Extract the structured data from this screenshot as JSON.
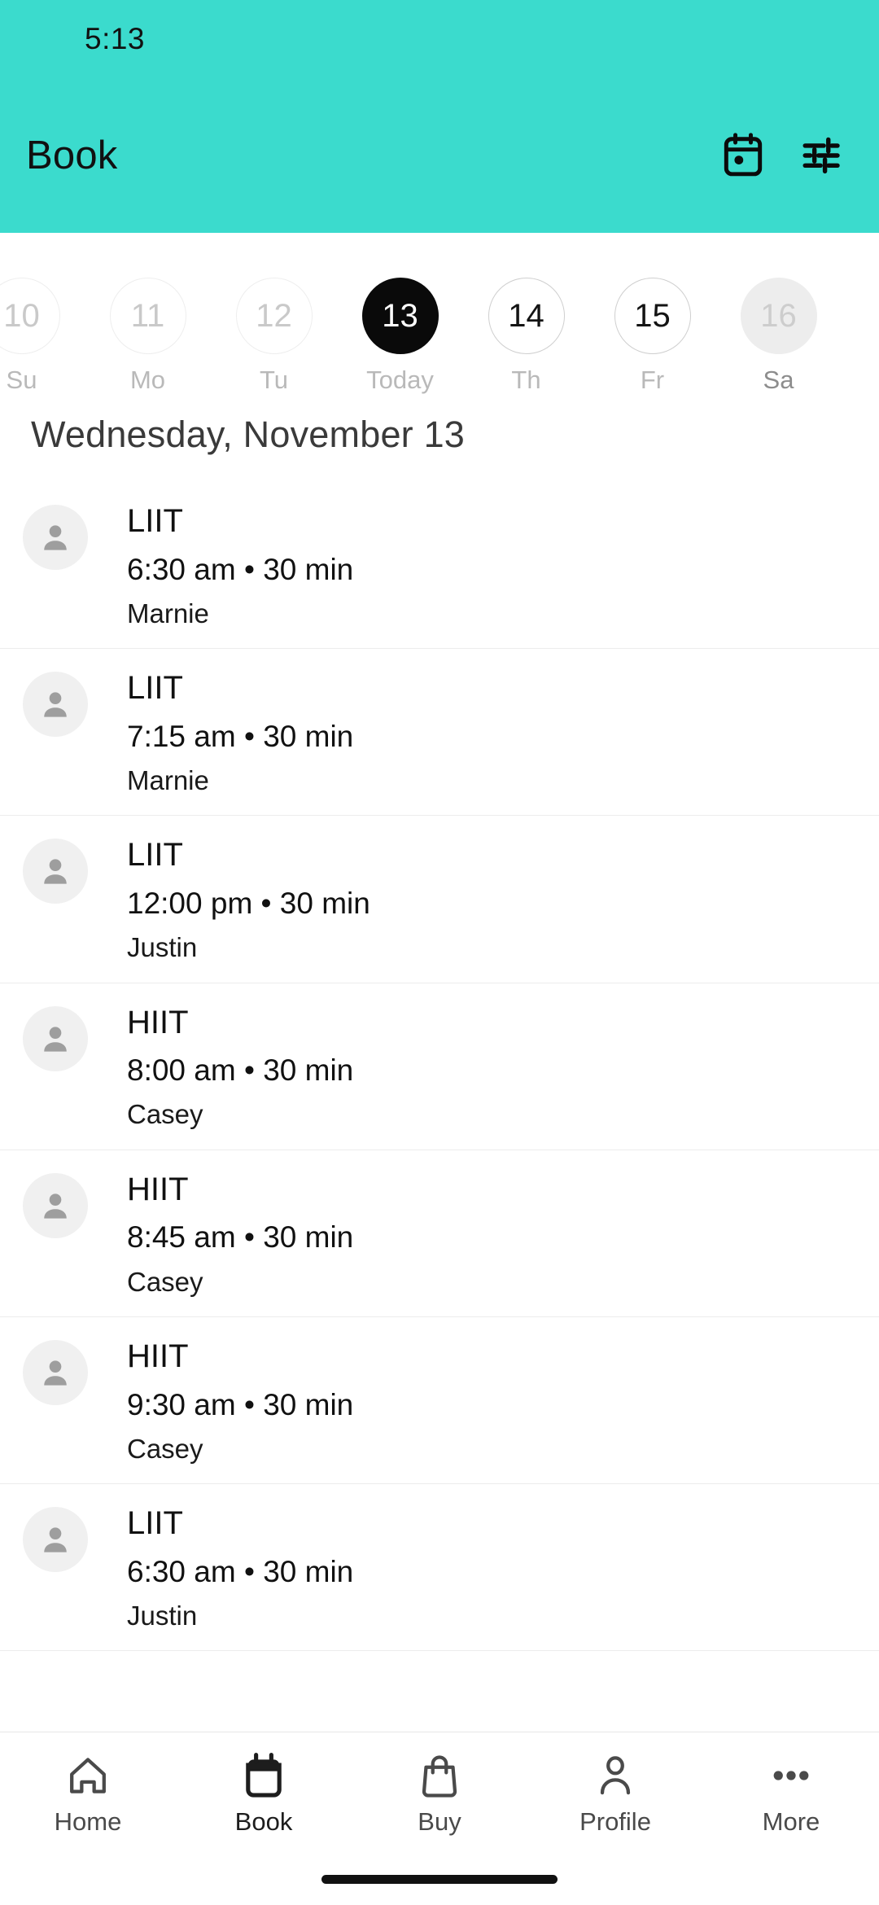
{
  "status_bar": {
    "clock": "5:13"
  },
  "app_bar": {
    "title": "Book",
    "calendar_icon": "calendar-icon",
    "filter_icon": "filter-sliders-icon"
  },
  "date_strip": {
    "days": [
      {
        "date": "10",
        "label": "Su",
        "state": "past"
      },
      {
        "date": "11",
        "label": "Mo",
        "state": "past"
      },
      {
        "date": "12",
        "label": "Tu",
        "state": "past"
      },
      {
        "date": "13",
        "label": "Today",
        "state": "today"
      },
      {
        "date": "14",
        "label": "Th",
        "state": "future"
      },
      {
        "date": "15",
        "label": "Fr",
        "state": "future"
      },
      {
        "date": "16",
        "label": "Sa",
        "state": "muted"
      }
    ]
  },
  "schedule": {
    "heading": "Wednesday, November 13",
    "classes": [
      {
        "name": "LIIT",
        "time": "6:30 am • 30 min",
        "coach": "Marnie",
        "avatar_icon": "person-avatar-icon"
      },
      {
        "name": "LIIT",
        "time": "7:15 am • 30 min",
        "coach": "Marnie",
        "avatar_icon": "person-avatar-icon"
      },
      {
        "name": "LIIT",
        "time": "12:00 pm • 30 min",
        "coach": "Justin",
        "avatar_icon": "person-avatar-icon"
      },
      {
        "name": "HIIT",
        "time": "8:00 am • 30 min",
        "coach": "Casey",
        "avatar_icon": "person-avatar-icon"
      },
      {
        "name": "HIIT",
        "time": "8:45 am • 30 min",
        "coach": "Casey",
        "avatar_icon": "person-avatar-icon"
      },
      {
        "name": "HIIT",
        "time": "9:30 am • 30 min",
        "coach": "Casey",
        "avatar_icon": "person-avatar-icon"
      },
      {
        "name": "LIIT",
        "time": "6:30 am • 30 min",
        "coach": "Justin",
        "avatar_icon": "person-avatar-icon"
      }
    ]
  },
  "tab_bar": {
    "active": "Book",
    "tabs": [
      {
        "label": "Home",
        "icon": "home-icon"
      },
      {
        "label": "Book",
        "icon": "calendar-filled-icon"
      },
      {
        "label": "Buy",
        "icon": "shopping-bag-icon"
      },
      {
        "label": "Profile",
        "icon": "person-icon"
      },
      {
        "label": "More",
        "icon": "ellipsis-icon"
      }
    ]
  },
  "colors": {
    "accent": "#3BDBCD",
    "selected_day": "#0a0a0a",
    "divider": "#ececec",
    "avatar_bg": "#f0f0f0",
    "avatar_fg": "#9e9e9e"
  }
}
